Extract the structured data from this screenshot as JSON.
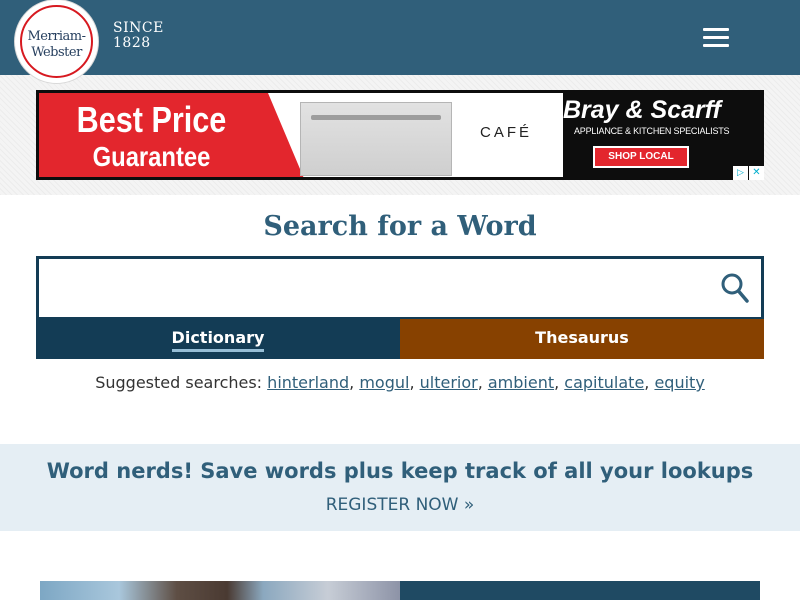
{
  "header": {
    "logo_line1": "Merriam-",
    "logo_line2": "Webster",
    "since_label": "SINCE",
    "since_year": "1828"
  },
  "ad": {
    "headline_1": "Best Price",
    "headline_2": "Guarantee",
    "product_brand": "CAFÉ",
    "advertiser": "Bray & Scarff",
    "tagline": "APPLIANCE & KITCHEN SPECIALISTS",
    "cta": "SHOP LOCAL",
    "adchoices_icon": "▷",
    "close_icon": "✕"
  },
  "search": {
    "title": "Search for a Word",
    "value": "",
    "placeholder": ""
  },
  "tabs": {
    "dictionary": "Dictionary",
    "thesaurus": "Thesaurus"
  },
  "suggested": {
    "label": "Suggested searches:",
    "items": [
      "hinterland",
      "mogul",
      "ulterior",
      "ambient",
      "capitulate",
      "equity"
    ],
    "separators": [
      ", ",
      ", ",
      ", ",
      ", ",
      ", ",
      ""
    ]
  },
  "promo": {
    "title": "Word nerds! Save words plus keep track of all your lookups",
    "cta": "REGISTER NOW »"
  },
  "colors": {
    "header_bg": "#305f7a",
    "dictionary_tab": "#133c55",
    "thesaurus_tab": "#874100",
    "promo_bg": "#e5eef4",
    "logo_red": "#d71920"
  }
}
